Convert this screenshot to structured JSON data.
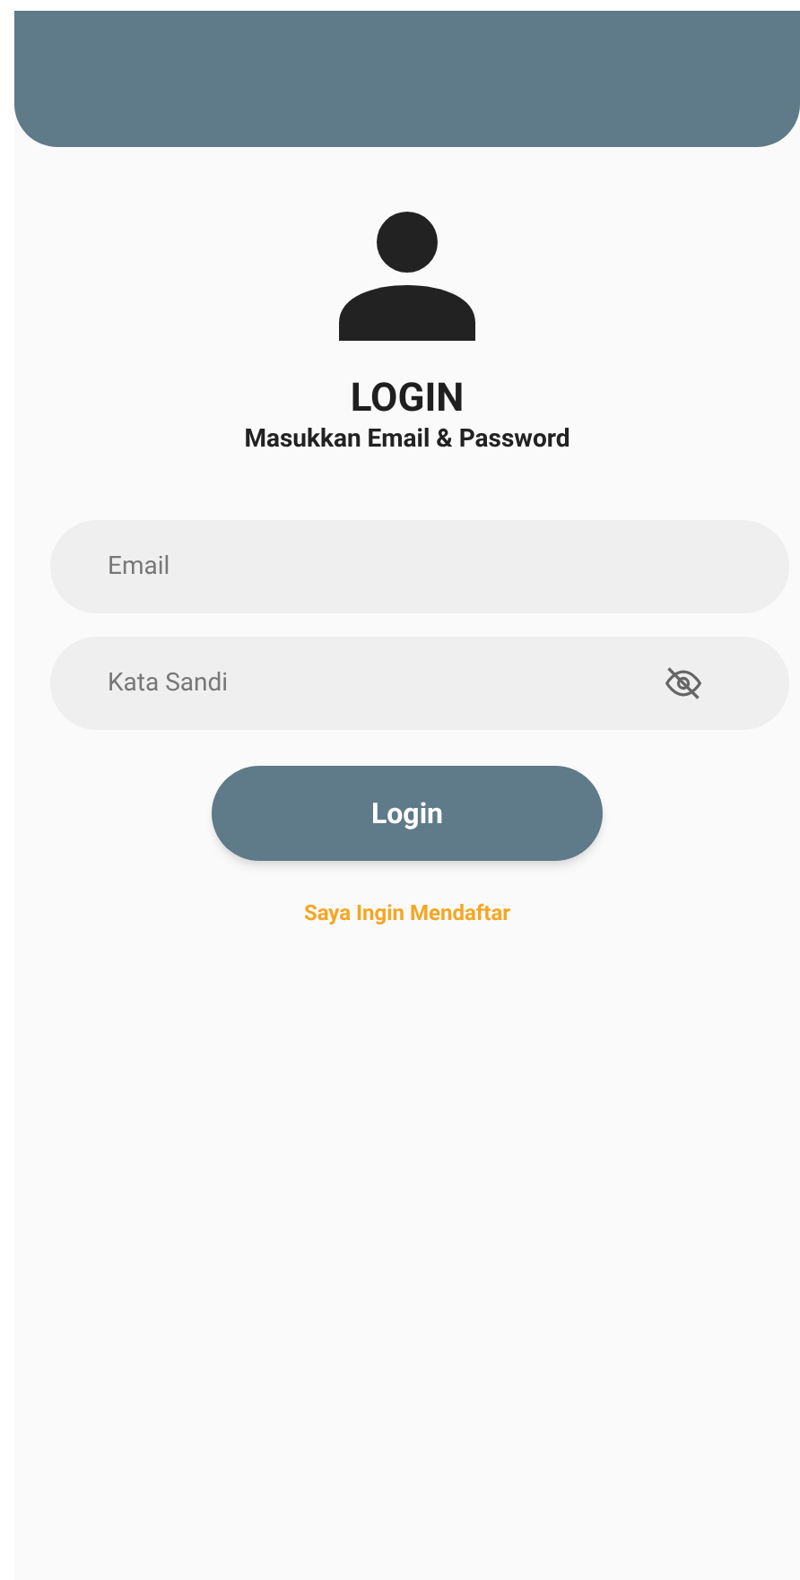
{
  "title": "LOGIN",
  "subtitle": "Masukkan Email & Password",
  "fields": [
    {
      "kind": "text",
      "placeholder": "Email"
    },
    {
      "kind": "password",
      "placeholder": "Kata Sandi",
      "password_visible": false
    }
  ],
  "login_button": "Login",
  "register_link": "Saya Ingin Mendaftar"
}
